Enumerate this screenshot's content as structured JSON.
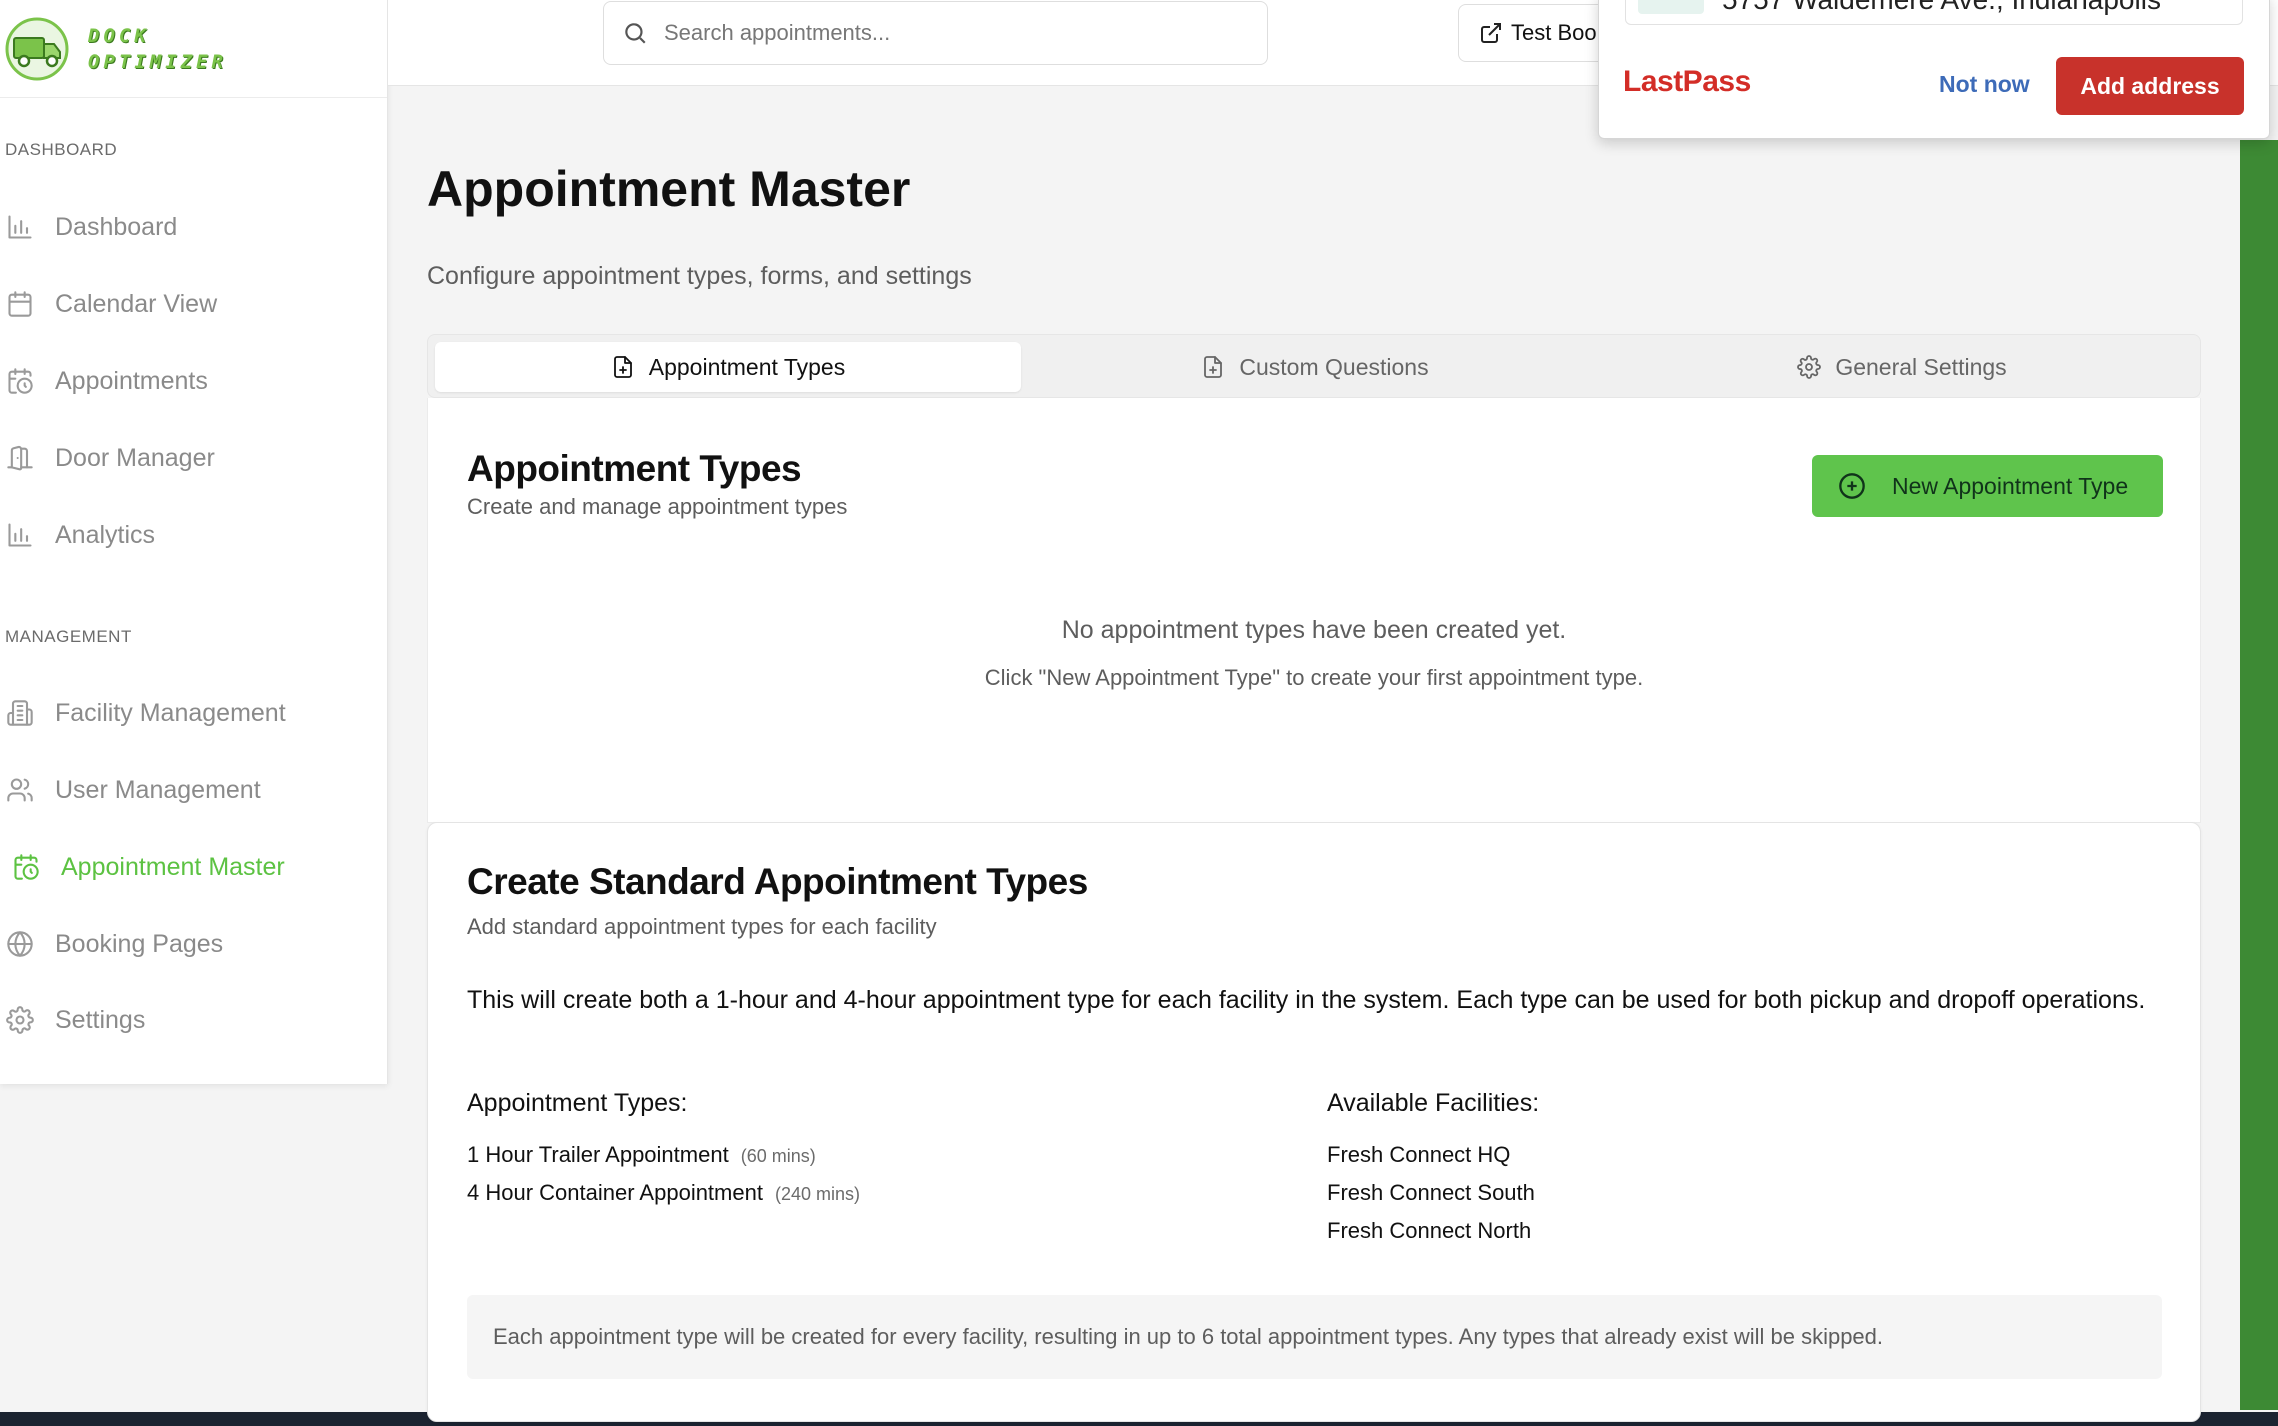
{
  "app": {
    "logo_line1": "DOCK",
    "logo_line2": "OPTIMIZER"
  },
  "sidebar": {
    "sections": [
      {
        "label": "DASHBOARD",
        "items": [
          {
            "label": "Dashboard",
            "icon": "bar-chart-icon"
          },
          {
            "label": "Calendar View",
            "icon": "calendar-icon"
          },
          {
            "label": "Appointments",
            "icon": "calendar-clock-icon"
          },
          {
            "label": "Door Manager",
            "icon": "door-icon"
          },
          {
            "label": "Analytics",
            "icon": "bar-chart-icon"
          }
        ]
      },
      {
        "label": "MANAGEMENT",
        "items": [
          {
            "label": "Facility Management",
            "icon": "building-icon"
          },
          {
            "label": "User Management",
            "icon": "users-icon"
          },
          {
            "label": "Appointment Master",
            "icon": "calendar-clock-icon",
            "active": true
          },
          {
            "label": "Booking Pages",
            "icon": "globe-icon"
          },
          {
            "label": "Settings",
            "icon": "gear-icon"
          }
        ]
      }
    ],
    "active_color": "#5cc242"
  },
  "topbar": {
    "search_placeholder": "Search appointments...",
    "test_button_label": "Test Boo"
  },
  "lastpass": {
    "address_text": "5757 Waldemere Ave., Indianapolis",
    "brand": "LastPass",
    "not_now": "Not now",
    "add_address": "Add address",
    "brand_color": "#d32d27"
  },
  "page": {
    "title": "Appointment Master",
    "subtitle": "Configure appointment types, forms, and settings"
  },
  "tabs": [
    {
      "label": "Appointment Types",
      "icon": "file-plus-icon",
      "active": true
    },
    {
      "label": "Custom Questions",
      "icon": "file-plus-icon",
      "active": false
    },
    {
      "label": "General Settings",
      "icon": "gear-icon",
      "active": false
    }
  ],
  "types_card": {
    "title": "Appointment Types",
    "subtitle": "Create and manage appointment types",
    "new_button": "New Appointment Type",
    "empty_title": "No appointment types have been created yet.",
    "empty_hint": "Click \"New Appointment Type\" to create your first appointment type."
  },
  "standard_card": {
    "title": "Create Standard Appointment Types",
    "subtitle": "Add standard appointment types for each facility",
    "description": "This will create both a 1-hour and 4-hour appointment type for each facility in the system. Each type can be used for both pickup and dropoff operations.",
    "types_heading": "Appointment Types:",
    "types": [
      {
        "name": "1 Hour Trailer Appointment",
        "duration": "(60 mins)"
      },
      {
        "name": "4 Hour Container Appointment",
        "duration": "(240 mins)"
      }
    ],
    "facilities_heading": "Available Facilities:",
    "facilities": [
      "Fresh Connect HQ",
      "Fresh Connect South",
      "Fresh Connect North"
    ],
    "note": "Each appointment type will be created for every facility, resulting in up to 6 total appointment types. Any types that already exist will be skipped."
  },
  "colors": {
    "primary_green": "#5fc44c",
    "lastpass_red": "#c8322b"
  }
}
